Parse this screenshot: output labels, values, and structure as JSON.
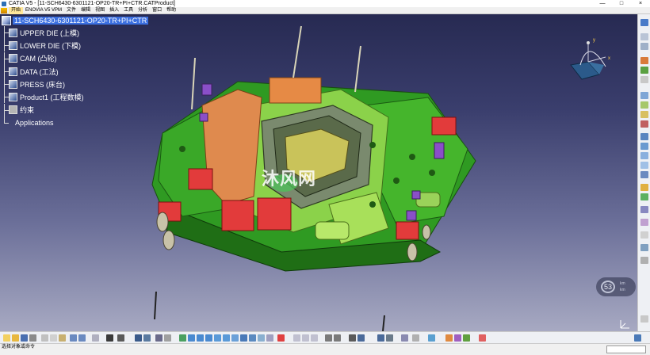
{
  "window": {
    "title": "CATIA V5 - [11-SCH6430-6301121-OP20-TR+PI+CTR.CATProduct]",
    "controls": [
      "—",
      "□",
      "×"
    ]
  },
  "menu": {
    "items": [
      "开始",
      "ENOVIA V5 VPM",
      "文件",
      "编辑",
      "视图",
      "插入",
      "工具",
      "分析",
      "窗口",
      "帮助"
    ]
  },
  "tree": {
    "root": "11-SCH6430-6301121-OP20-TR+PI+CTR",
    "nodes": [
      "UPPER DIE (上模)",
      "LOWER DIE (下模)",
      "CAM (凸轮)",
      "DATA (工法)",
      "PRESS (床台)",
      "Product1 (工程数模)",
      "约束",
      "Applications"
    ]
  },
  "watermark": {
    "text": "沐风网"
  },
  "gauge": {
    "value": "53",
    "unit_top": "km",
    "unit_bottom": "km"
  },
  "compass": {
    "axis_x": "x",
    "axis_y": "y"
  },
  "status": {
    "text": "选择对象或命令"
  },
  "colors": {
    "viewport_top": "#272a52",
    "viewport_bottom": "#a7a9c2",
    "die_green": "#3fae2a",
    "die_red": "#e23b3b",
    "die_orange": "#e0884a",
    "tree_selected": "#3b6fe0"
  }
}
